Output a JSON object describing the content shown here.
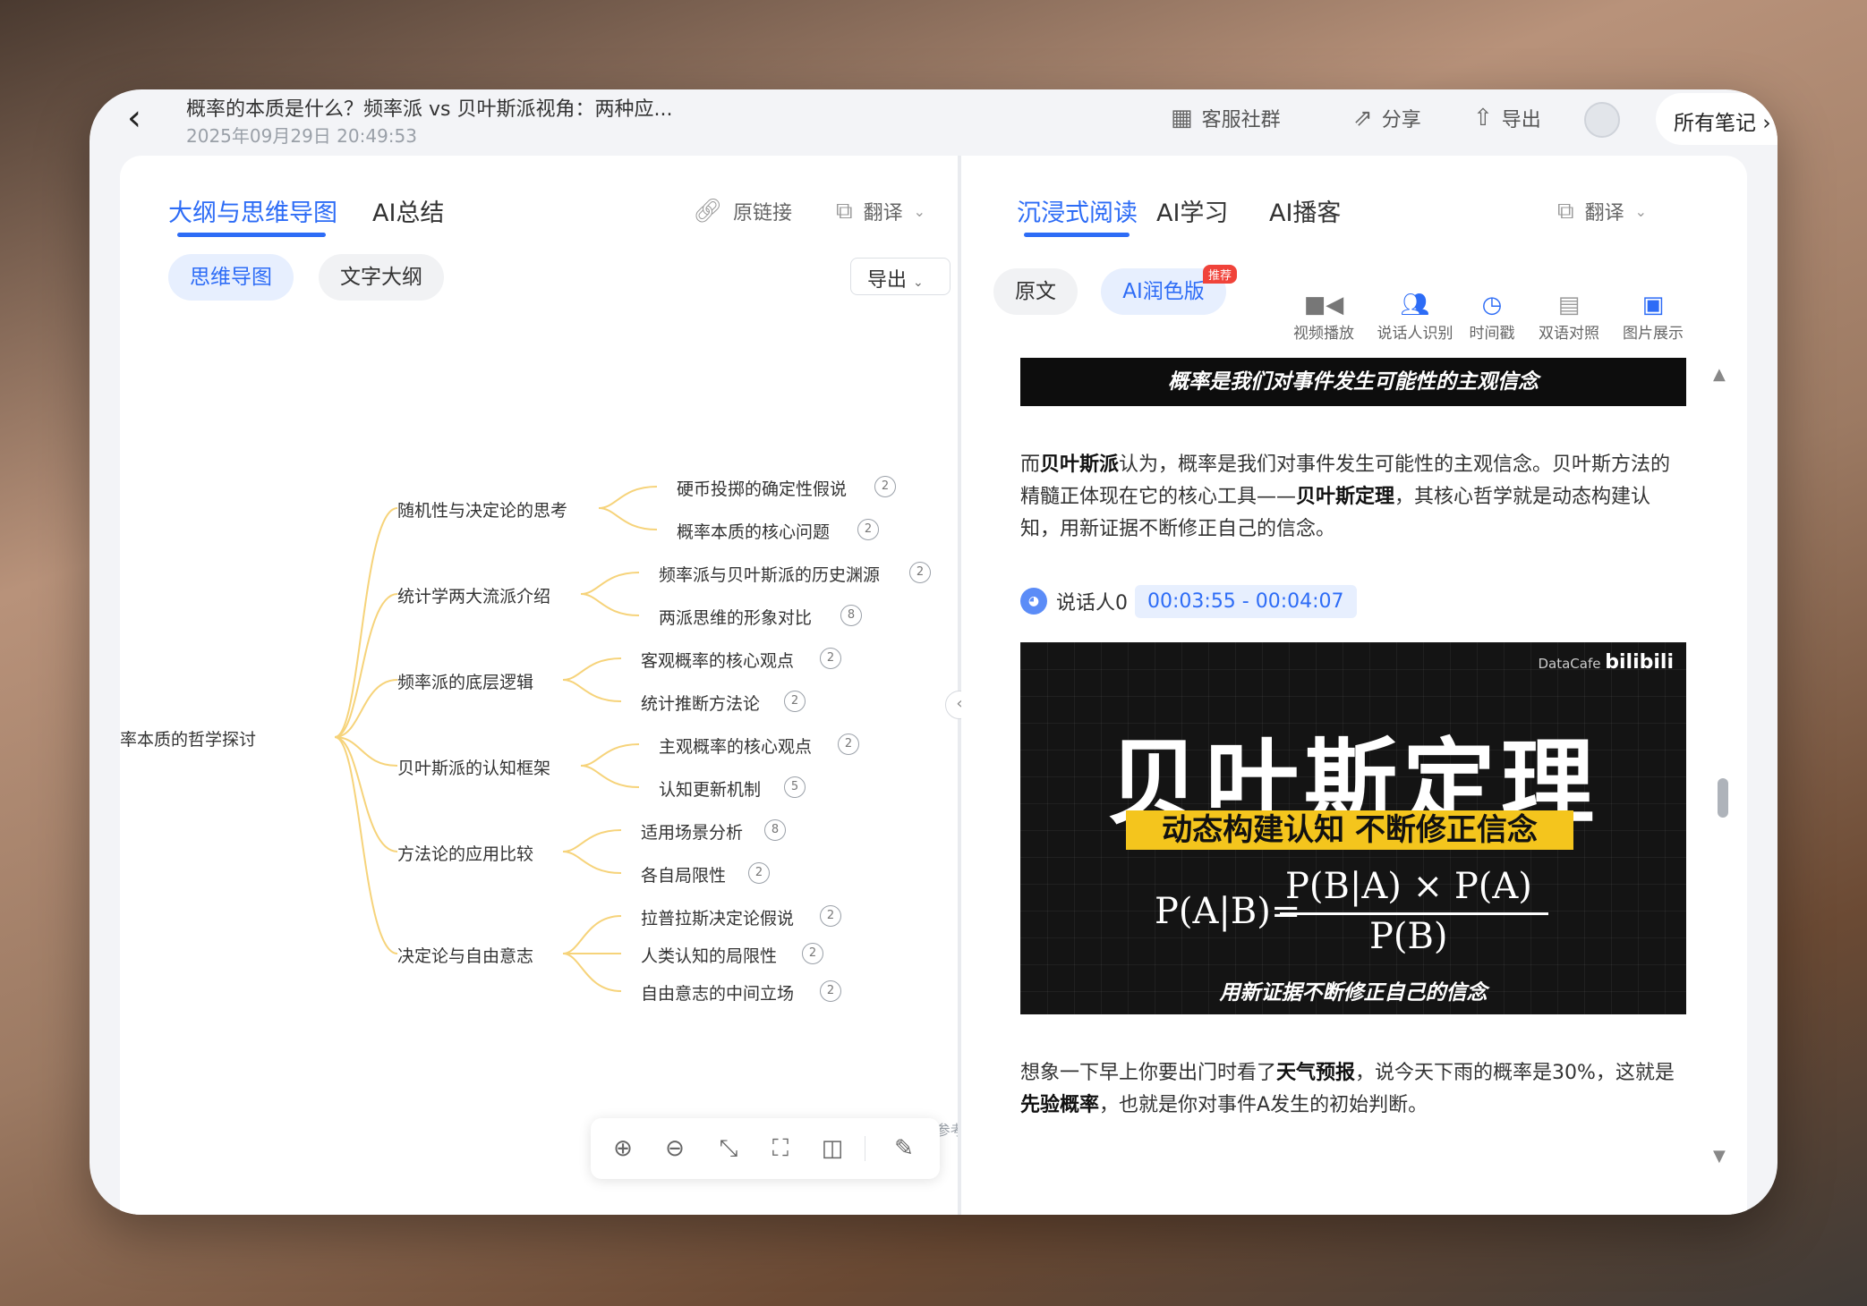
{
  "header": {
    "title": "概率的本质是什么？频率派 vs 贝叶斯派视角：两种应...",
    "date": "2025年09月29日 20:49:53",
    "actions": {
      "community": "客服社群",
      "share": "分享",
      "export": "导出",
      "all_notes": "所有笔记"
    }
  },
  "left": {
    "tabs": [
      "大纲与思维导图",
      "AI总结"
    ],
    "tools": {
      "original_link": "原链接",
      "translate": "翻译"
    },
    "subtabs": [
      "思维导图",
      "文字大纲"
    ],
    "export": "导出",
    "mindmap": {
      "root": "率本质的哲学探讨",
      "branches": [
        {
          "label": "随机性与决定论的思考",
          "children": [
            {
              "label": "硬币投掷的确定性假说",
              "count": "2"
            },
            {
              "label": "概率本质的核心问题",
              "count": "2"
            }
          ]
        },
        {
          "label": "统计学两大流派介绍",
          "children": [
            {
              "label": "频率派与贝叶斯派的历史渊源",
              "count": "2"
            },
            {
              "label": "两派思维的形象对比",
              "count": "8"
            }
          ]
        },
        {
          "label": "频率派的底层逻辑",
          "children": [
            {
              "label": "客观概率的核心观点",
              "count": "2"
            },
            {
              "label": "统计推断方法论",
              "count": "2"
            }
          ]
        },
        {
          "label": "贝叶斯派的认知框架",
          "children": [
            {
              "label": "主观概率的核心观点",
              "count": "2"
            },
            {
              "label": "认知更新机制",
              "count": "5"
            }
          ]
        },
        {
          "label": "方法论的应用比较",
          "children": [
            {
              "label": "适用场景分析",
              "count": "8"
            },
            {
              "label": "各自局限性",
              "count": "2"
            }
          ]
        },
        {
          "label": "决定论与自由意志",
          "children": [
            {
              "label": "拉普拉斯决定论假说",
              "count": "2"
            },
            {
              "label": "人类认知的局限性",
              "count": "2"
            },
            {
              "label": "自由意志的中间立场",
              "count": "2"
            }
          ]
        }
      ]
    },
    "disclaimer": "以上内容由AI生成仅供参考"
  },
  "right": {
    "tabs": [
      "沉浸式阅读",
      "AI学习",
      "AI播客"
    ],
    "translate": "翻译",
    "subtabs": [
      "原文",
      "AI润色版"
    ],
    "hot_badge": "推荐",
    "features": [
      {
        "label": "视频播放",
        "icon": "video-camera-icon"
      },
      {
        "label": "说话人识别",
        "icon": "speakers-icon"
      },
      {
        "label": "时间戳",
        "icon": "clock-icon"
      },
      {
        "label": "双语对照",
        "icon": "bilingual-icon"
      },
      {
        "label": "图片展示",
        "icon": "image-icon"
      }
    ],
    "banner": "概率是我们对事件发生可能性的主观信念",
    "para1": {
      "a": "而",
      "b1": "贝叶斯派",
      "c": "认为，概率是我们对事件发生可能性的主观信念。贝叶斯方法的精髓正体现在它的核心工具——",
      "b2": "贝叶斯定理",
      "d": "，其核心哲学就是动态构建认知，用新证据不断修正自己的信念。"
    },
    "speaker": {
      "name": "说话人0",
      "time": "00:03:55 - 00:04:07"
    },
    "video": {
      "brand": "DataCafe",
      "brand_logo": "bilibili",
      "title": "贝叶斯定理",
      "subtitle": "动态构建认知 不断修正信念",
      "formula_lhs": "P(A|B)=",
      "formula_num": "P(B|A) × P(A)",
      "formula_den": "P(B)",
      "caption": "用新证据不断修正自己的信念"
    },
    "para2": {
      "a": "想象一下早上你要出门时看了",
      "b1": "天气预报",
      "c": "，说今天下雨的概率是30%，这就是",
      "b2": "先验概率",
      "d": "，也就是你对事件A发生的初始判断。"
    }
  }
}
